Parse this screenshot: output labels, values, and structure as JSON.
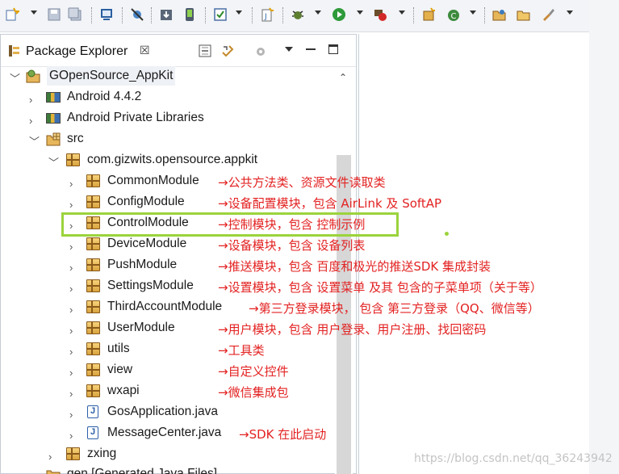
{
  "panel": {
    "title": "Package Explorer",
    "close_glyph": "☒"
  },
  "tree": [
    {
      "label": "GOpenSource_AppKit",
      "icon": "project-icon",
      "expanded": true
    },
    {
      "label": "Android 4.4.2",
      "icon": "library-icon",
      "expanded": false
    },
    {
      "label": "Android Private Libraries",
      "icon": "library-icon",
      "expanded": false
    },
    {
      "label": "src",
      "icon": "source-folder-icon",
      "expanded": true
    },
    {
      "label": "com.gizwits.opensource.appkit",
      "icon": "package-icon",
      "expanded": true
    },
    {
      "label": "CommonModule",
      "icon": "package-icon",
      "expanded": false
    },
    {
      "label": "ConfigModule",
      "icon": "package-icon",
      "expanded": false
    },
    {
      "label": "ControlModule",
      "icon": "package-icon",
      "expanded": false
    },
    {
      "label": "DeviceModule",
      "icon": "package-icon",
      "expanded": false
    },
    {
      "label": "PushModule",
      "icon": "package-icon",
      "expanded": false
    },
    {
      "label": "SettingsModule",
      "icon": "package-icon",
      "expanded": false
    },
    {
      "label": "ThirdAccountModule",
      "icon": "package-icon",
      "expanded": false
    },
    {
      "label": "UserModule",
      "icon": "package-icon",
      "expanded": false
    },
    {
      "label": "utils",
      "icon": "package-icon",
      "expanded": false
    },
    {
      "label": "view",
      "icon": "package-icon",
      "expanded": false
    },
    {
      "label": "wxapi",
      "icon": "package-icon",
      "expanded": false
    },
    {
      "label": "GosApplication.java",
      "icon": "java-file-icon",
      "expanded": false
    },
    {
      "label": "MessageCenter.java",
      "icon": "java-file-icon",
      "expanded": false
    },
    {
      "label": "zxing",
      "icon": "package-icon",
      "expanded": false
    },
    {
      "label": "gen [Generated Java Files]",
      "icon": "generated-folder-icon",
      "expanded": false
    }
  ],
  "annotations": {
    "common": "公共方法类、资源文件读取类",
    "config": "设备配置模块，包含 AirLink 及 SoftAP",
    "control": "控制模块，包含 控制示例",
    "device": "设备模块，包含 设备列表",
    "push": "推送模块，包含 百度和极光的推送SDK 集成封装",
    "settings": "设置模块，包含 设置菜单 及其 包含的子菜单项（关于等）",
    "third": "第三方登录模块， 包含 第三方登录（QQ、微信等）",
    "user": "用户模块，包含 用户登录、用户注册、找回密码",
    "utils": "工具类",
    "view": "自定义控件",
    "wxapi": "微信集成包",
    "message": "SDK 在此启动",
    "arrow": "→"
  },
  "watermark": "https://blog.csdn.net/qq_36243942",
  "colors": {
    "annotation": "#e32222",
    "highlight": "#9bd33c"
  }
}
